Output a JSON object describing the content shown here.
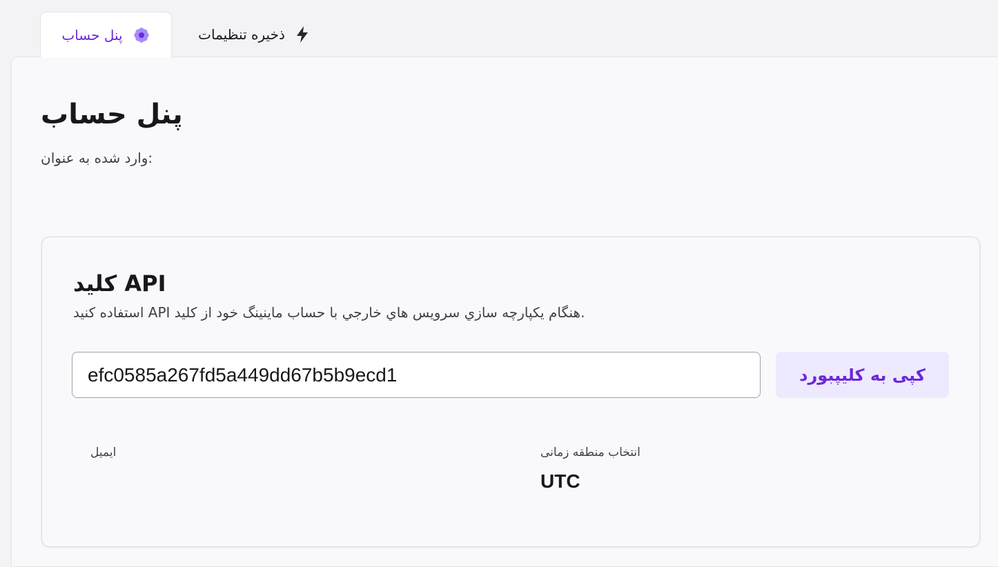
{
  "tabs": [
    {
      "label": "پنل حساب",
      "icon": "flower-icon",
      "active": true
    },
    {
      "label": "ذخیره تنظیمات",
      "icon": "bolt-icon",
      "active": false
    }
  ],
  "page": {
    "title": "پنل حساب",
    "subtitle": "وارد شده به عنوان:"
  },
  "api_card": {
    "title": "کلید API",
    "description": "استفاده کنید API هنگام یکپارچه سازي سرویس هاي خارجي با حساب ماينينگ خود از کلید.",
    "key_value": "efc0585a267fd5a449dd67b5b9ecd1",
    "copy_label": "کپی به کلیپبورد"
  },
  "fields": {
    "email_label": "ایمیل",
    "email_value": "",
    "timezone_label": "انتخاب منطقه زمانی",
    "timezone_value": "UTC"
  },
  "colors": {
    "accent": "#6d28d9",
    "accent_bg": "#ede9fe",
    "icon_purple": "#8b5cf6"
  }
}
